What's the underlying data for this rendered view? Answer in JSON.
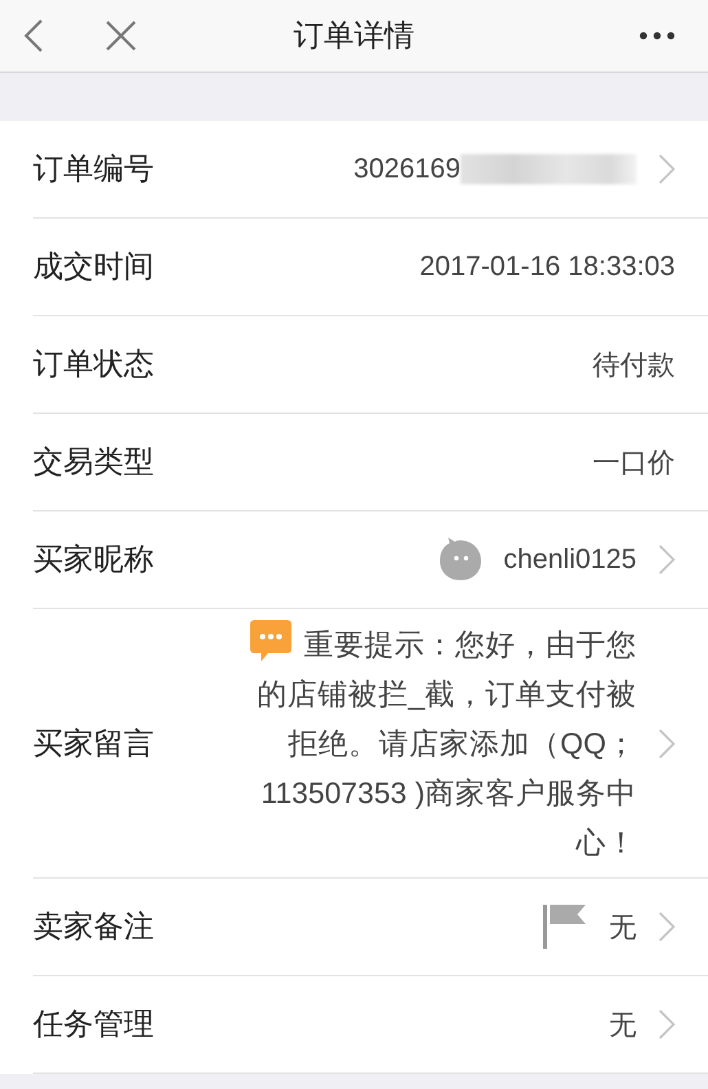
{
  "nav": {
    "title": "订单详情"
  },
  "rows": [
    {
      "label": "订单编号",
      "value": "3026169",
      "redacted": true,
      "chevron": true
    },
    {
      "label": "成交时间",
      "value": "2017-01-16 18:33:03",
      "chevron": false
    },
    {
      "label": "订单状态",
      "value": "待付款",
      "chevron": false
    },
    {
      "label": "交易类型",
      "value": "一口价",
      "chevron": false
    },
    {
      "label": "买家昵称",
      "value": "chenli0125",
      "kind": "avatar",
      "chevron": true
    },
    {
      "label": "买家留言",
      "value": "重要提示：您好，由于您的店铺被拦_截，订单支付被拒绝。请店家添加（QQ；113507353 )商家客户服务中心！",
      "kind": "message",
      "chevron": true
    },
    {
      "label": "卖家备注",
      "value": "无",
      "kind": "flag",
      "chevron": true
    },
    {
      "label": "任务管理",
      "value": "无",
      "chevron": true
    }
  ]
}
